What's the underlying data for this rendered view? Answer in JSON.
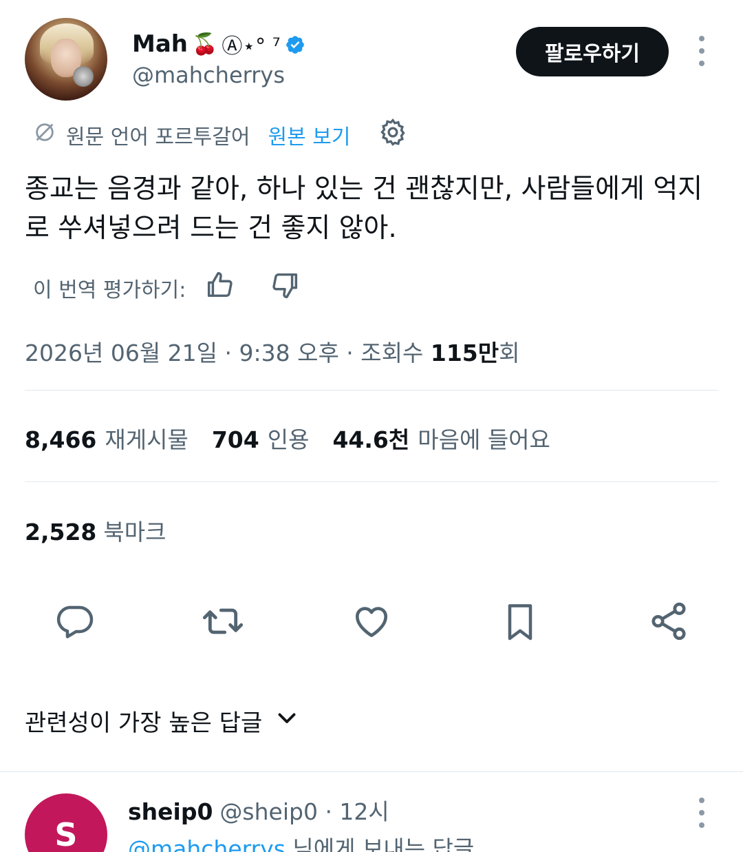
{
  "author": {
    "display_name": "Mah",
    "name_emoji": "🍒",
    "name_suffix": "Ⓐ⋆° ⁷",
    "handle": "@mahcherrys",
    "verified_icon": "verified-badge-icon",
    "avatar_icon": "user-avatar"
  },
  "follow_button": "팔로우하기",
  "translation": {
    "label": "원문 언어 포르투갈어",
    "view_original": "원본 보기"
  },
  "tweet_text": "종교는 음경과 같아, 하나 있는 건 괜찮지만, 사람들에게 억지로 쑤셔넣으려 드는 건 좋지 않아.",
  "rate_translation": "이 번역 평가하기:",
  "timestamp": {
    "date_time": "2026년 06월 21일 · 9:38 오후 · 조회수 ",
    "views_num": "115만",
    "views_suffix": "회"
  },
  "stats": {
    "retweets_num": "8,466",
    "retweets_label": "재게시물",
    "quotes_num": "704",
    "quotes_label": "인용",
    "likes_num": "44.6천",
    "likes_label": "마음에 들어요",
    "bookmarks_num": "2,528",
    "bookmarks_label": "북마크"
  },
  "sort_label": "관련성이 가장 높은 답글",
  "reply": {
    "avatar_letter": "S",
    "name": "sheip0",
    "handle": "@sheip0",
    "time": " · 12시",
    "reply_to_mention": "@mahcherrys",
    "reply_to_suffix": " 님에게 보내는 답글"
  },
  "colors": {
    "accent": "#1d9bf0",
    "text": "#0f1419",
    "secondary": "#536471",
    "reply_avatar": "#c2185b"
  }
}
